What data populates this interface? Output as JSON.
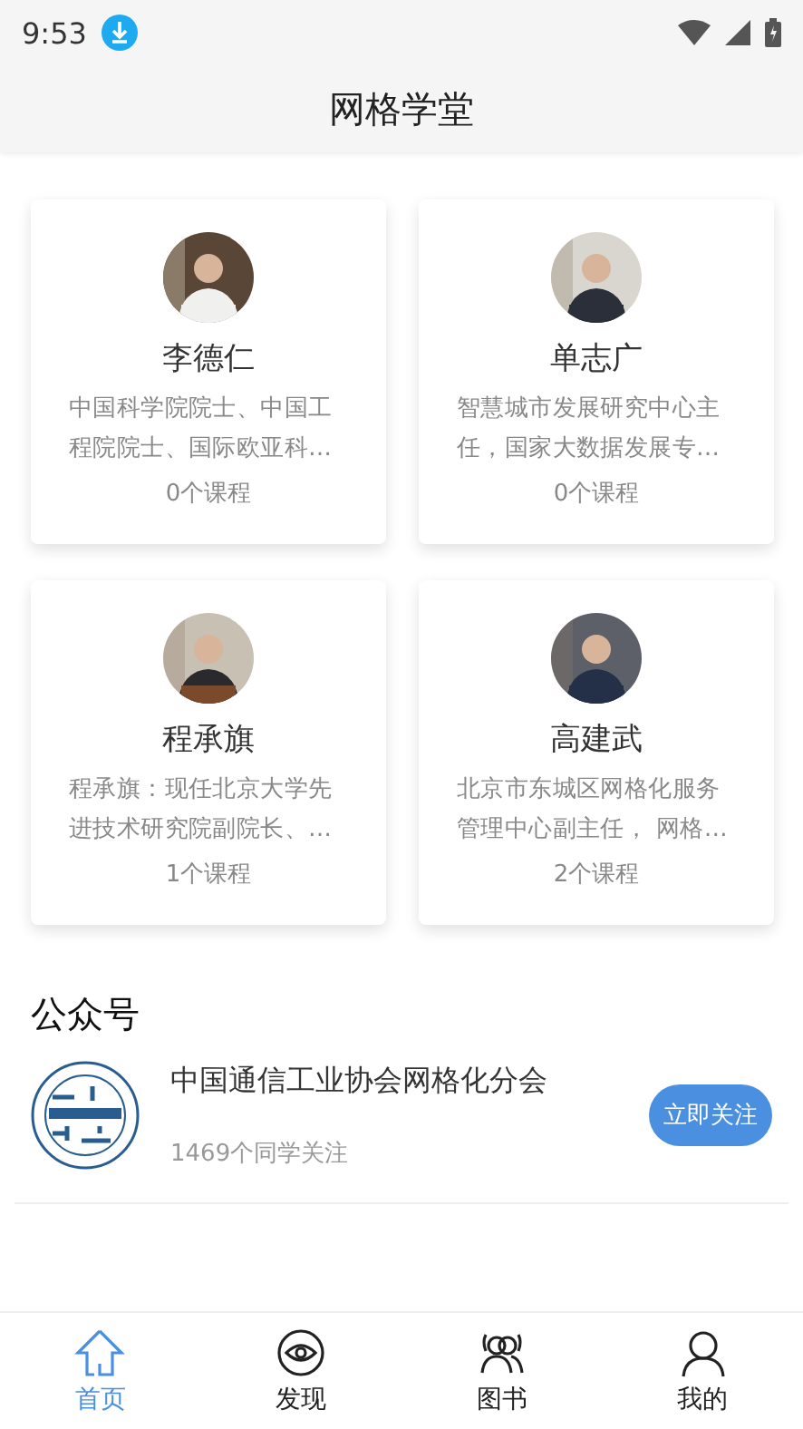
{
  "status_bar": {
    "time": "9:53"
  },
  "header": {
    "title": "网格学堂"
  },
  "experts": [
    {
      "name": "李德仁",
      "description": "中国科学院院士、中国工程院院士、国际欧亚科…",
      "courses": "0个课程"
    },
    {
      "name": "单志广",
      "description": "智慧城市发展研究中心主任，国家大数据发展专…",
      "courses": "0个课程"
    },
    {
      "name": "程承旗",
      "description": "程承旗：现任北京大学先进技术研究院副院长、…",
      "courses": "1个课程"
    },
    {
      "name": "高建武",
      "description": "北京市东城区网格化服务管理中心副主任， 网格…",
      "courses": "2个课程"
    }
  ],
  "official_accounts": {
    "title": "公众号",
    "items": [
      {
        "name": "中国通信工业协会网格化分会",
        "followers": "1469个同学关注",
        "button": "立即关注"
      }
    ]
  },
  "tab_bar": [
    {
      "label": "首页",
      "selected": true
    },
    {
      "label": "发现",
      "selected": false
    },
    {
      "label": "图书",
      "selected": false
    },
    {
      "label": "我的",
      "selected": false
    }
  ]
}
